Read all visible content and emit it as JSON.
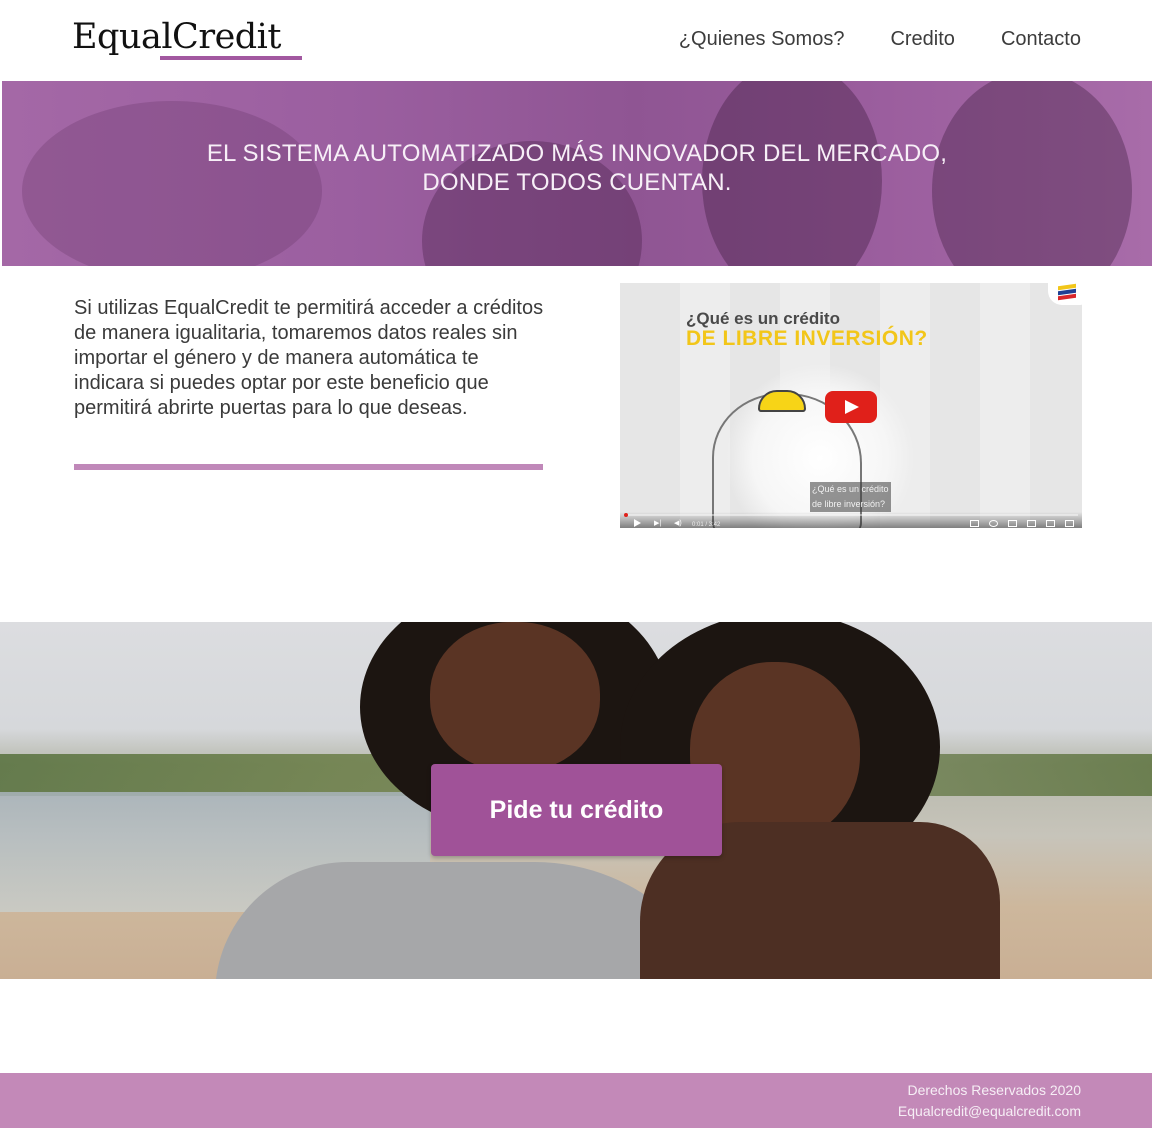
{
  "brand": {
    "name": "EqualCredit",
    "accent": "#a258a0"
  },
  "nav": {
    "items": [
      {
        "label": "¿Quienes Somos?"
      },
      {
        "label": "Credito"
      },
      {
        "label": "Contacto"
      }
    ]
  },
  "hero": {
    "line1": "EL SISTEMA AUTOMATIZADO MÁS INNOVADOR DEL MERCADO,",
    "line2": "DONDE TODOS CUENTAN.",
    "overlay_color": "#9b5fa0"
  },
  "intro": {
    "text": "Si utilizas EqualCredit  te permitirá acceder a créditos de manera igualitaria, tomaremos datos reales sin importar el género y  de manera automática te indicara si puedes optar por este beneficio que permitirá abrirte puertas para lo que deseas."
  },
  "video": {
    "title_line1": "¿Qué es un crédito",
    "title_line2": "DE LIBRE INVERSIÓN?",
    "caption_line1": "¿Qué es un crédito",
    "caption_line2": "de libre inversión?",
    "time": "0:01 / 3:42",
    "progress": 0.005,
    "play_icon": "play-icon",
    "play_button_color": "#e0201a"
  },
  "cta": {
    "button_label": "Pide tu crédito",
    "button_color": "#a05298"
  },
  "footer": {
    "rights": "Derechos Reservados 2020",
    "email": "Equalcredit@equalcredit.com",
    "background": "#c389b8"
  }
}
